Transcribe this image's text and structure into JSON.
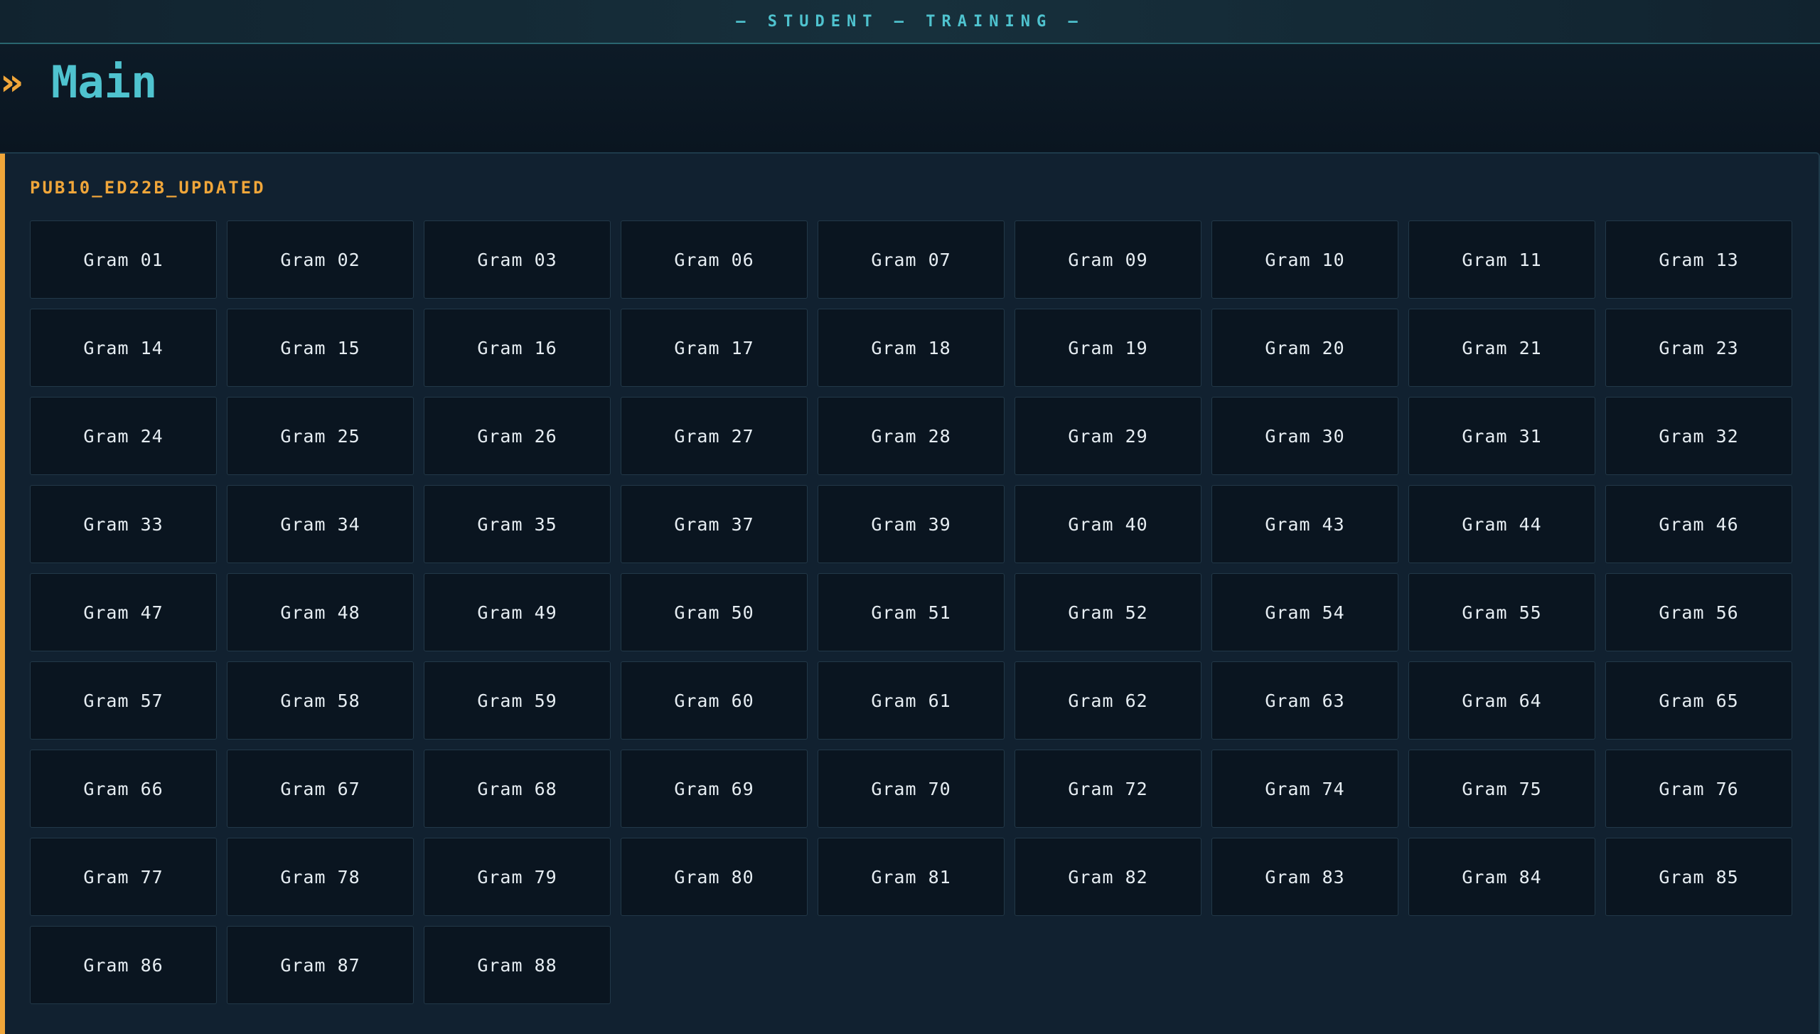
{
  "app": {
    "title": "— STUDENT — TRAINING —"
  },
  "header": {
    "icon": "double-chevron-right-icon",
    "chevron_glyph": "»",
    "title": "Main"
  },
  "section": {
    "label": "PUB10_ED22B_UPDATED",
    "items": [
      "Gram 01",
      "Gram 02",
      "Gram 03",
      "Gram 06",
      "Gram 07",
      "Gram 09",
      "Gram 10",
      "Gram 11",
      "Gram 13",
      "Gram 14",
      "Gram 15",
      "Gram 16",
      "Gram 17",
      "Gram 18",
      "Gram 19",
      "Gram 20",
      "Gram 21",
      "Gram 23",
      "Gram 24",
      "Gram 25",
      "Gram 26",
      "Gram 27",
      "Gram 28",
      "Gram 29",
      "Gram 30",
      "Gram 31",
      "Gram 32",
      "Gram 33",
      "Gram 34",
      "Gram 35",
      "Gram 37",
      "Gram 39",
      "Gram 40",
      "Gram 43",
      "Gram 44",
      "Gram 46",
      "Gram 47",
      "Gram 48",
      "Gram 49",
      "Gram 50",
      "Gram 51",
      "Gram 52",
      "Gram 54",
      "Gram 55",
      "Gram 56",
      "Gram 57",
      "Gram 58",
      "Gram 59",
      "Gram 60",
      "Gram 61",
      "Gram 62",
      "Gram 63",
      "Gram 64",
      "Gram 65",
      "Gram 66",
      "Gram 67",
      "Gram 68",
      "Gram 69",
      "Gram 70",
      "Gram 72",
      "Gram 74",
      "Gram 75",
      "Gram 76",
      "Gram 77",
      "Gram 78",
      "Gram 79",
      "Gram 80",
      "Gram 81",
      "Gram 82",
      "Gram 83",
      "Gram 84",
      "Gram 85",
      "Gram 86",
      "Gram 87",
      "Gram 88"
    ]
  },
  "colors": {
    "accent": "#f0a63a",
    "title": "#4fc3cf",
    "background": "#0b1622",
    "panel": "#112130",
    "button": "#0a1520"
  }
}
